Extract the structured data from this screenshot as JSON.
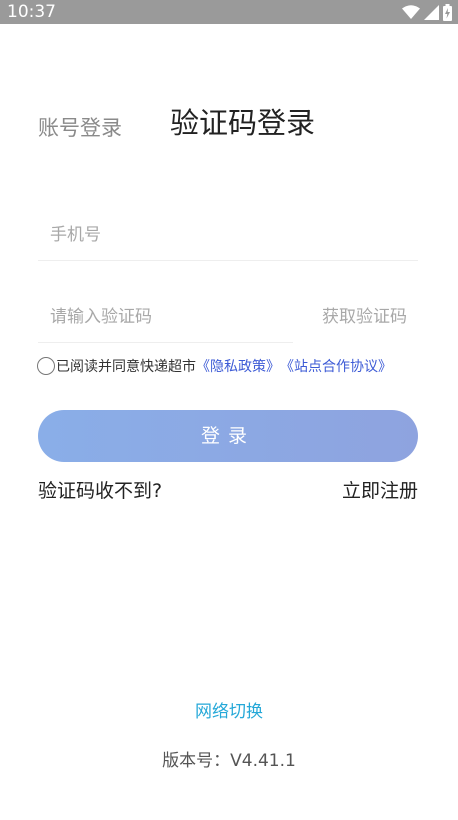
{
  "status_bar": {
    "time": "10:37",
    "icons": [
      "wifi-icon",
      "cellular-signal-icon",
      "battery-charging-icon"
    ]
  },
  "tabs": {
    "account_login": "账号登录",
    "sms_login": "验证码登录"
  },
  "form": {
    "phone_placeholder": "手机号",
    "phone_value": "",
    "code_placeholder": "请输入验证码",
    "code_value": "",
    "get_code_label": "获取验证码"
  },
  "agreement": {
    "checked": false,
    "text": "已阅读并同意快递超市",
    "privacy_link": "《隐私政策》",
    "cooperation_link": "《站点合作协议》"
  },
  "login_button": "登录",
  "links": {
    "no_code": "验证码收不到?",
    "register": "立即注册"
  },
  "footer": {
    "network_switch": "网络切换",
    "version": "版本号：V4.41.1"
  },
  "colors": {
    "accent_button": "#8aaee8",
    "link_blue": "#3d5bd6",
    "network_link": "#25a8d8",
    "status_bar": "#9a9a9a"
  }
}
